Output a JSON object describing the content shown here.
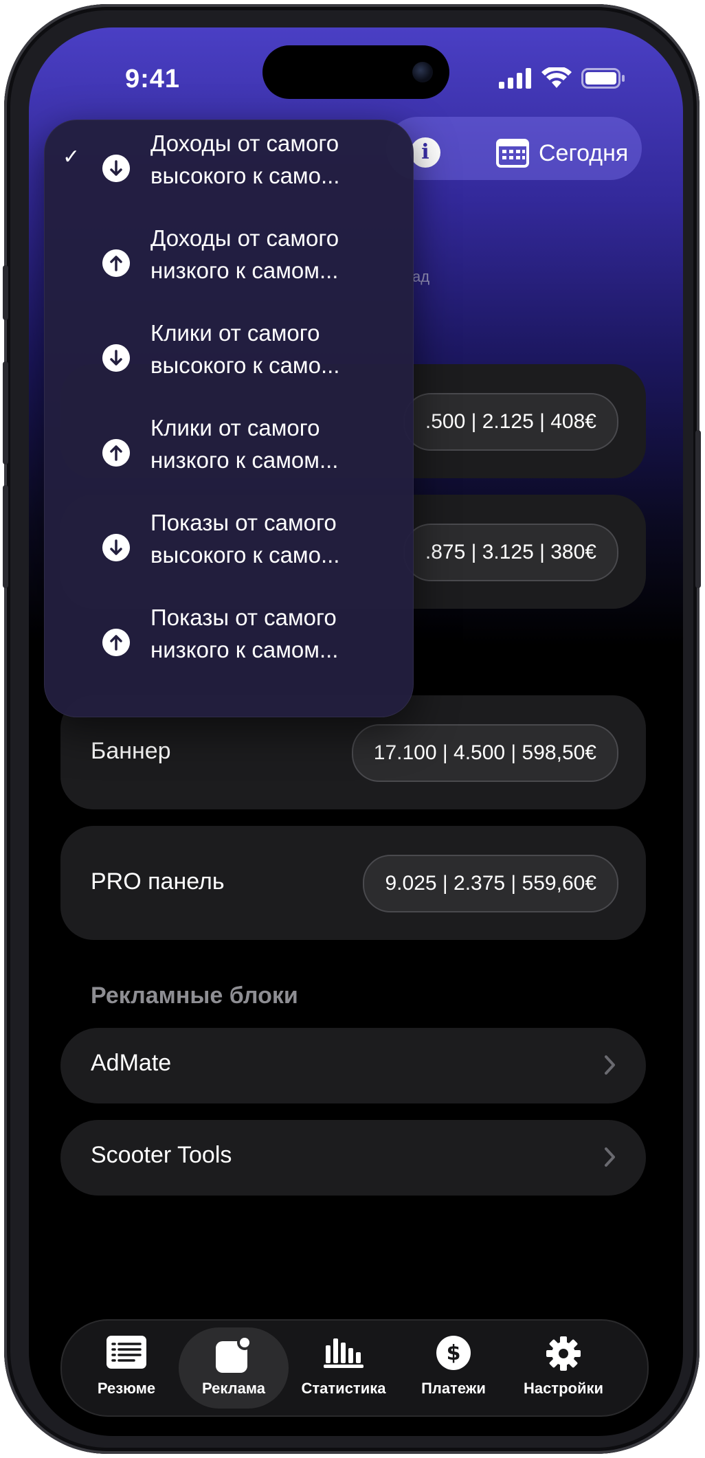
{
  "status_bar": {
    "time": "9:41"
  },
  "header": {
    "date_button": "Сегодня",
    "info_icon": "info-icon",
    "calendar_icon": "calendar-icon",
    "subtext_fragment": "ад"
  },
  "sort_menu": {
    "items": [
      {
        "label": "Доходы от самого высокого к само...",
        "line1": "Доходы от самого",
        "line2": "высокого к само...",
        "direction": "down",
        "selected": true
      },
      {
        "label": "Доходы от самого низкого к самом...",
        "line1": "Доходы от самого",
        "line2": "низкого к самом...",
        "direction": "up",
        "selected": false
      },
      {
        "label": "Клики от самого высокого к само...",
        "line1": "Клики от самого",
        "line2": "высокого к само...",
        "direction": "down",
        "selected": false
      },
      {
        "label": "Клики от самого низкого к самом...",
        "line1": "Клики от самого",
        "line2": "низкого к самом...",
        "direction": "up",
        "selected": false
      },
      {
        "label": "Показы от самого высокого к само...",
        "line1": "Показы от самого",
        "line2": "высокого к само...",
        "direction": "down",
        "selected": false
      },
      {
        "label": "Показы от самого низкого к самом...",
        "line1": "Показы от самого",
        "line2": "низкого к самом...",
        "direction": "up",
        "selected": false
      }
    ]
  },
  "ad_types": [
    {
      "label": "",
      "stats": ".500 | 2.125 | 408€"
    },
    {
      "label": "",
      "stats": ".875 | 3.125 | 380€"
    },
    {
      "label": "Баннер",
      "stats": "17.100 | 4.500 | 598,50€"
    },
    {
      "label": "PRO панель",
      "stats": "9.025 | 2.375 | 559,60€"
    }
  ],
  "ad_blocks": {
    "title": "Рекламные блоки",
    "items": [
      {
        "label": "AdMate"
      },
      {
        "label": "Scooter Tools"
      }
    ]
  },
  "tab_bar": {
    "tabs": [
      {
        "label": "Резюме",
        "icon": "list-icon",
        "active": false
      },
      {
        "label": "Реклама",
        "icon": "ads-icon",
        "active": true
      },
      {
        "label": "Статистика",
        "icon": "bar-chart-icon",
        "active": false
      },
      {
        "label": "Платежи",
        "icon": "dollar-icon",
        "active": false
      },
      {
        "label": "Настройки",
        "icon": "gear-icon",
        "active": false
      }
    ]
  }
}
